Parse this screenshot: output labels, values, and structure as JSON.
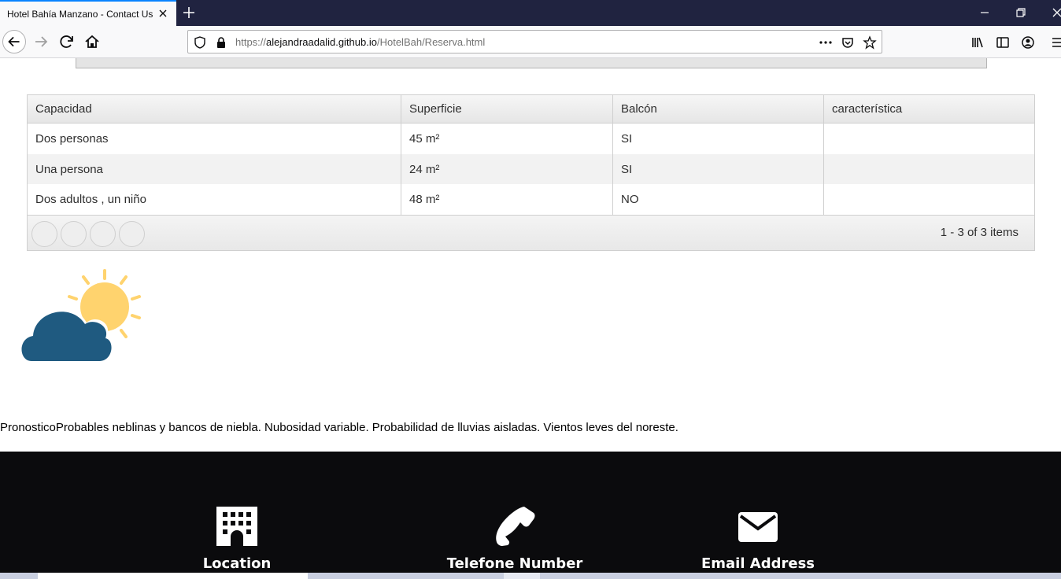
{
  "browser": {
    "tab_title": "Hotel Bahía Manzano - Contact Us",
    "url_prefix": "https://",
    "url_host": "alejandraadalid.github.io",
    "url_path": "/HotelBah/Reserva.html"
  },
  "grid": {
    "headers": [
      "Capacidad",
      "Superficie",
      "Balcón",
      "característica"
    ],
    "rows": [
      [
        "Dos personas",
        "45 m²",
        "SI",
        ""
      ],
      [
        "Una persona",
        "24 m²",
        "SI",
        ""
      ],
      [
        "Dos adultos , un niño",
        "48 m²",
        "NO",
        ""
      ]
    ],
    "pager_info": "1 - 3 of 3 items"
  },
  "weather": {
    "icon": "partly-cloudy-icon",
    "forecast": "PronosticoProbables neblinas y bancos de niebla. Nubosidad variable. Probabilidad de lluvias aisladas. Vientos leves del noreste."
  },
  "footer": {
    "location_label": "Location",
    "phone_label": "Telefone Number",
    "email_label": "Email Address"
  },
  "colors": {
    "titlebar": "#202340",
    "footer": "#0b0b0d",
    "sun": "#ffd36e",
    "cloud": "#1f5a80"
  }
}
